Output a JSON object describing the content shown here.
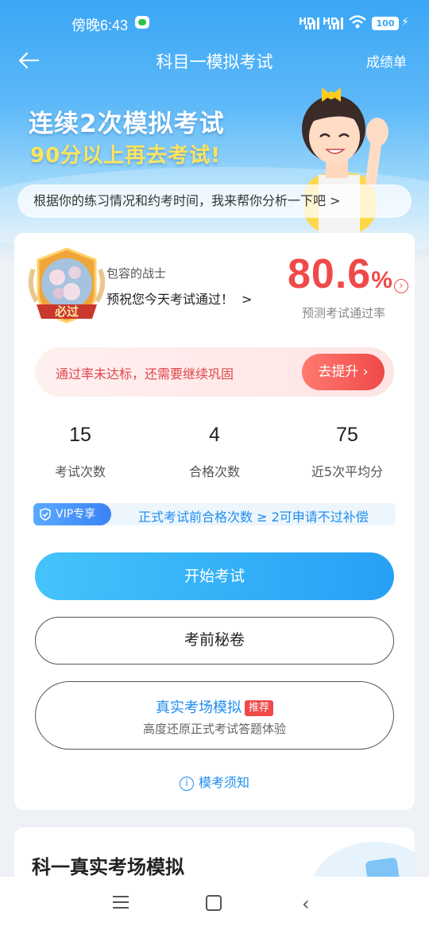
{
  "status_bar": {
    "time": "傍晚6:43",
    "network1": "HD",
    "network2": "HD",
    "battery": "100"
  },
  "navbar": {
    "title": "科目一模拟考试",
    "right_label": "成绩单"
  },
  "banner": {
    "line1": "连续2次模拟考试",
    "line2": "90分以上再去考试!",
    "analyze_text": "根据你的练习情况和约考时间，我来帮你分析一下吧 >"
  },
  "profile": {
    "medal_label": "必过",
    "name": "包容的战士",
    "wish": "预祝您今天考试通过！",
    "wish_arrow": ">",
    "pass_rate_value": "80.6",
    "pass_rate_unit": "%",
    "pass_rate_label": "预测考试通过率"
  },
  "warning": {
    "text": "通过率未达标，还需要继续巩固",
    "button": "去提升 ›"
  },
  "stats": [
    {
      "value": "15",
      "label": "考试次数"
    },
    {
      "value": "4",
      "label": "合格次数"
    },
    {
      "value": "75",
      "label": "近5次平均分"
    }
  ],
  "vip": {
    "badge": "VIP专享",
    "text": "正式考试前合格次数 ≥ 2可申请不过补偿"
  },
  "buttons": {
    "start": "开始考试",
    "secret": "考前秘卷",
    "real_title": "真实考场模拟",
    "real_tag": "推荐",
    "real_sub": "高度还原正式考试答题体验"
  },
  "notice": {
    "icon": "i",
    "text": "模考须知"
  },
  "section2": {
    "title": "科一真实考场模拟"
  },
  "colors": {
    "primary": "#27a0f5",
    "danger": "#f0494a",
    "accent_yellow": "#ffe45c"
  }
}
